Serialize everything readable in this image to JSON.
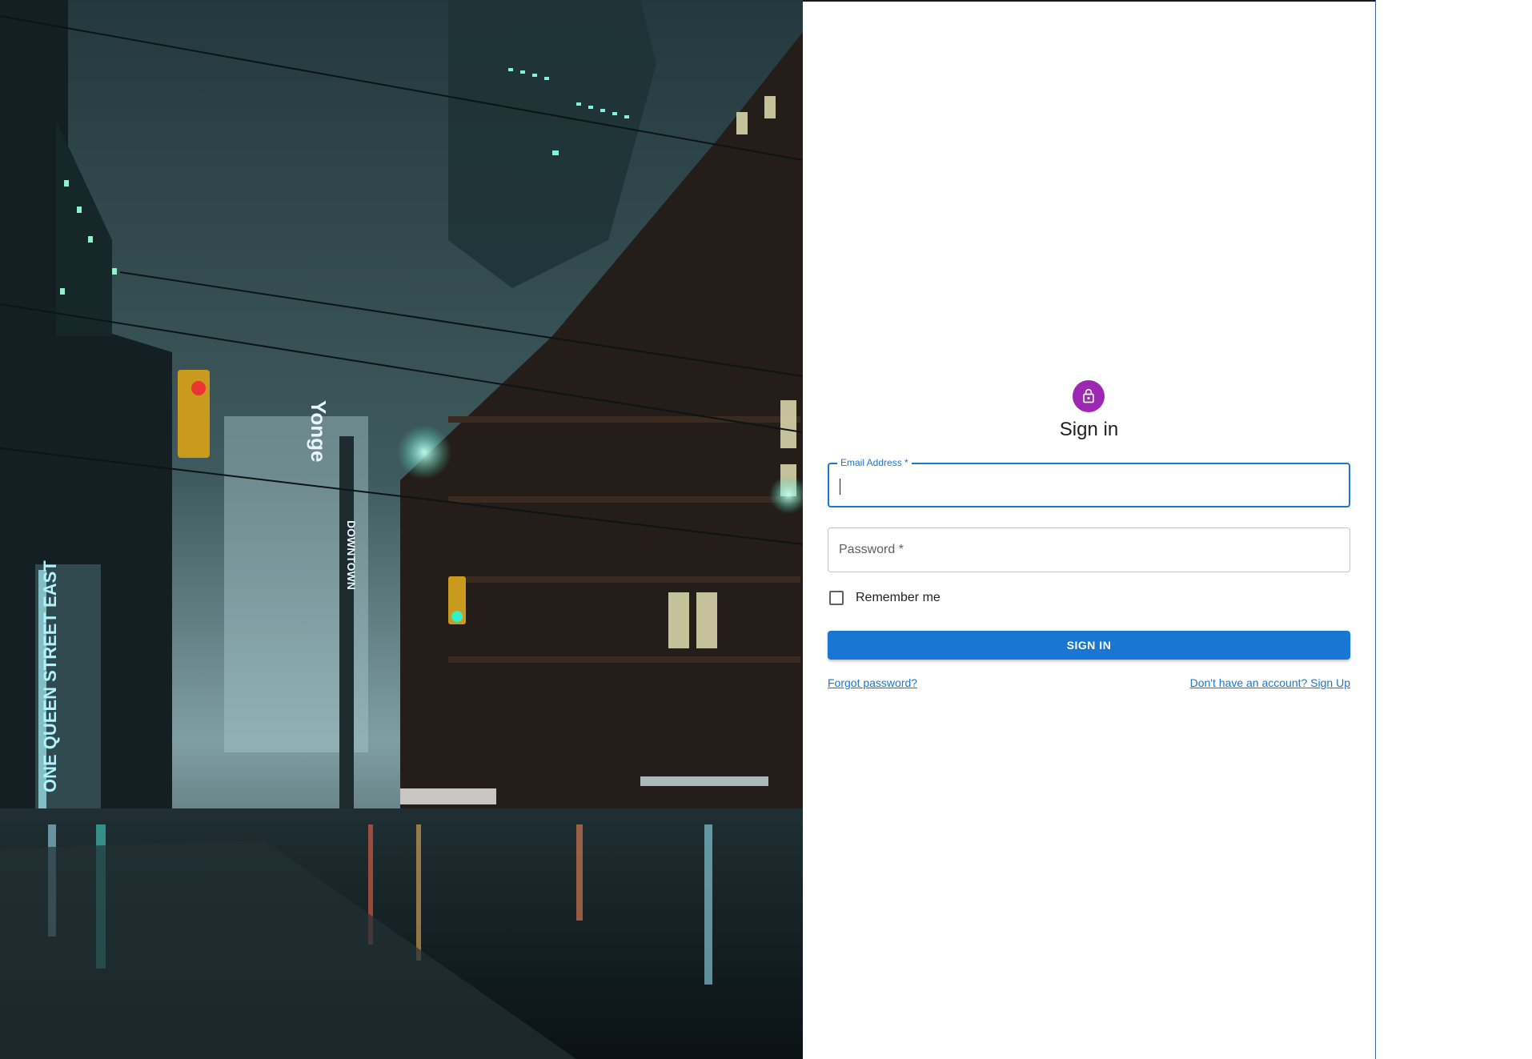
{
  "hero": {
    "sign_vertical": "ONE QUEEN STREET EAST",
    "sign_yonge": "Yonge",
    "sign_downtown": "DOWNTOWN"
  },
  "form": {
    "icon": "lock-icon",
    "title": "Sign in",
    "email": {
      "label": "Email Address *",
      "value": ""
    },
    "password": {
      "label": "Password *",
      "value": ""
    },
    "remember": {
      "label": "Remember me",
      "checked": false
    },
    "submit_label": "SIGN IN",
    "forgot_link": "Forgot password?",
    "signup_link": "Don't have an account? Sign Up"
  },
  "colors": {
    "primary": "#1976d2",
    "avatar": "#9c27b0"
  }
}
